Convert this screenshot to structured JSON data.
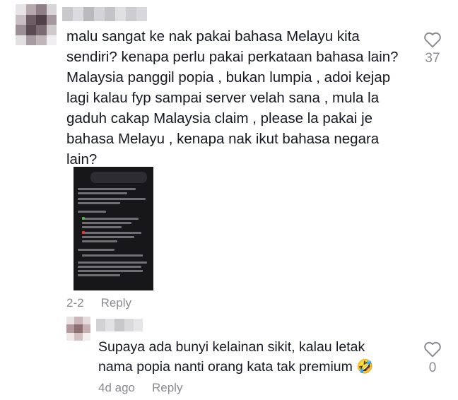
{
  "comments": [
    {
      "text": "malu sangat ke nak pakai bahasa Melayu kita\nsendiri? kenapa perlu pakai perkataan bahasa lain?\nMalaysia panggil popia , bukan lumpia , adoi kejap\nlagi kalau fyp sampai server velah sana , mula la\ngaduh cakap Malaysia claim , please la pakai je\nbahasa Melayu , kenapa nak ikut bahasa negara\nlain?",
      "likes": "37",
      "date": "2-2",
      "reply_label": "Reply",
      "attachment_icon": "chat-screenshot"
    },
    {
      "text": "Supaya ada bunyi kelainan sikit, kalau letak\nnama popia nanti orang kata tak premium 🤣",
      "likes": "0",
      "date": "4d ago",
      "reply_label": "Reply"
    }
  ],
  "icons": {
    "like": "heart-outline-icon"
  },
  "colors": {
    "text": "#161823",
    "muted": "#8a8b91",
    "background": "#ffffff"
  }
}
